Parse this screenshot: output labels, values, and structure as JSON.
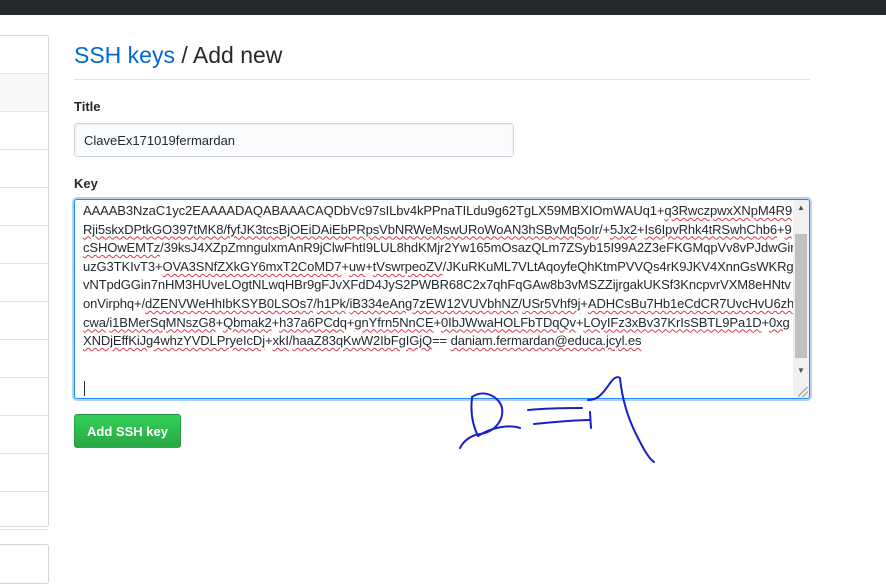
{
  "heading": {
    "link_label": "SSH keys",
    "separator": " / ",
    "current": "Add new"
  },
  "form": {
    "title_label": "Title",
    "title_value": "ClaveEx171019fermardan",
    "key_label": "Key",
    "key_segments": [
      {
        "text": "AAAAB3NzaC1yc2EAAAADAQABAAACAQDbVc97sILbv4kPPnaTILdu9g62TgLX59MBXIOmWAUq1+",
        "squiggly": false
      },
      {
        "text": "q3RwczpwxXNpM4R9Rji5skxDPtkGO397tMK8/fyfJK3tcsBjOEiDAiEbPRpsVbNRWeMswURoWoAN3hSBvMq5oIr",
        "squiggly": true
      },
      {
        "text": "/+",
        "squiggly": false
      },
      {
        "text": "5Jx2",
        "squiggly": true
      },
      {
        "text": "+",
        "squiggly": false
      },
      {
        "text": "Is6IpvRhk4tRSwhChb6",
        "squiggly": true
      },
      {
        "text": "+",
        "squiggly": false
      },
      {
        "text": "9cSHOwEMTz",
        "squiggly": true
      },
      {
        "text": "/39ksJ4XZpZmngulxmAnR9jClwFhtI9LUL8hdKMjr2Yw165mOsazQLm7ZSyb15I99A2Z3eFKGMqpVv8vPJdwGiruzG3TKIvT3+",
        "squiggly": false
      },
      {
        "text": "OVA3SNfZXkGY6mxT2CoMD7",
        "squiggly": true
      },
      {
        "text": "+",
        "squiggly": false
      },
      {
        "text": "uw",
        "squiggly": true
      },
      {
        "text": "+",
        "squiggly": false
      },
      {
        "text": "tVswrpeoZV",
        "squiggly": true
      },
      {
        "text": "/JKuRKuML7VLtAqoyfeQhKtmPVVQs4rK9JKV4XnnGsWKRgvNTpdGGin7nHM3HUveLOgtNLwqHBr9gFJvXFdD4JyS2PWBR68C2x7qhFqGAw8b3vMSZZijrgakUKSf3KncpvrVXM8eHNtvonVirphq+/",
        "squiggly": false
      },
      {
        "text": "dZENVWeHhIbKSYB0LSOs7",
        "squiggly": true
      },
      {
        "text": "/",
        "squiggly": false
      },
      {
        "text": "h1Pk",
        "squiggly": true
      },
      {
        "text": "/",
        "squiggly": false
      },
      {
        "text": "iB334eAng7zEW12VUVbhNZ",
        "squiggly": true
      },
      {
        "text": "/",
        "squiggly": false
      },
      {
        "text": "USr5Vhf9j",
        "squiggly": true
      },
      {
        "text": "+",
        "squiggly": false
      },
      {
        "text": "ADHCsBu7Hb1eCdCR7UvcHvU6zhcwa",
        "squiggly": true
      },
      {
        "text": "/",
        "squiggly": false
      },
      {
        "text": "i1BMerSqMNszG8",
        "squiggly": true
      },
      {
        "text": "+",
        "squiggly": false
      },
      {
        "text": "Qbmak2",
        "squiggly": true
      },
      {
        "text": "+",
        "squiggly": false
      },
      {
        "text": "h37a6PCdq",
        "squiggly": true
      },
      {
        "text": "+",
        "squiggly": false
      },
      {
        "text": "gnYfrn5NnCE",
        "squiggly": true
      },
      {
        "text": "+",
        "squiggly": false
      },
      {
        "text": "0IbJWwaHOLFbTDqQv",
        "squiggly": true
      },
      {
        "text": "+",
        "squiggly": false
      },
      {
        "text": "LOyIFz3xBv37KrIsSBTL9Pa1D",
        "squiggly": true
      },
      {
        "text": "+",
        "squiggly": false
      },
      {
        "text": "0xgXNDjEffKiJg4whzYVDLPryeIcDj",
        "squiggly": true
      },
      {
        "text": "+",
        "squiggly": false
      },
      {
        "text": "xkI",
        "squiggly": true
      },
      {
        "text": "/",
        "squiggly": false
      },
      {
        "text": "haaZ83qKwW2IbFgIGjQ",
        "squiggly": true
      },
      {
        "text": "== ",
        "squiggly": false
      },
      {
        "text": "daniam.fermardan@educa.jcyl.es",
        "squiggly": true
      }
    ]
  },
  "actions": {
    "add_key_label": "Add SSH key"
  },
  "sidebar": {
    "rows": 13,
    "selected_index": 1
  },
  "colors": {
    "link": "#0366d6",
    "primary_button": "#28a745",
    "focus_border": "#2188ff",
    "spell_error": "#d73a49",
    "scribble": "#1a20c8",
    "topbar": "#24292e"
  },
  "icons": {
    "scroll_up": "▲",
    "scroll_down": "▼"
  }
}
